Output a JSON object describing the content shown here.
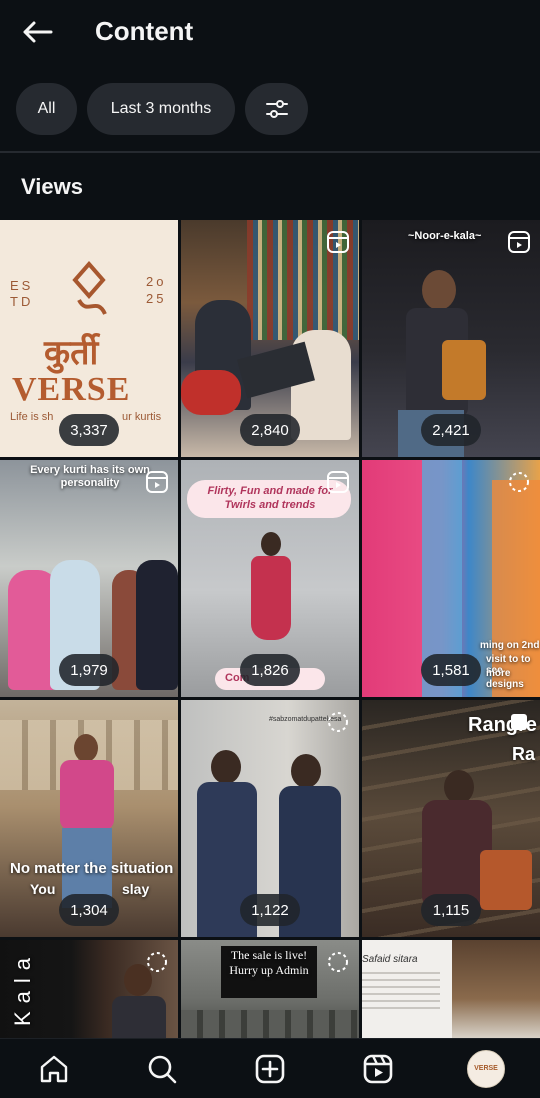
{
  "header": {
    "title": "Content"
  },
  "filters": {
    "all_label": "All",
    "range_label": "Last 3 months"
  },
  "section": {
    "title": "Views"
  },
  "tiles": [
    {
      "views": "3,337",
      "caption_top": "ES",
      "caption_top2": "TD",
      "caption_year1": "2o",
      "caption_year2": "25",
      "brand_hindi": "कुर्ती",
      "brand": "VERSE",
      "tagline": "Life is sh",
      "tagline2": "ur kurtis"
    },
    {
      "views": "2,840"
    },
    {
      "views": "2,421",
      "caption": "~Noor-e-kala~"
    },
    {
      "views": "1,979",
      "caption": "Every kurti has its own personality"
    },
    {
      "views": "1,826",
      "caption": "Flirty, Fun and made for Twirls and trends",
      "caption_bottom": "Com"
    },
    {
      "views": "1,581",
      "caption": "ming on 2nd",
      "caption2": "visit to to see",
      "caption3": "more designs"
    },
    {
      "views": "1,304",
      "caption": "No matter the situation",
      "caption2": "You",
      "caption3": "slay"
    },
    {
      "views": "1,122",
      "caption": "#sabzomatdupattekesa"
    },
    {
      "views": "1,115",
      "caption": "Rangre",
      "caption2": "Ra"
    },
    {
      "caption": "Kala"
    },
    {
      "caption": "The sale is live! Hurry up Admin"
    },
    {
      "caption": "Safaid sitara"
    }
  ],
  "nav": {
    "avatar_text": "VERSE"
  },
  "colors": {
    "background": "#0c1014",
    "chip": "#262a30",
    "text": "#f5f5f5"
  },
  "icons": [
    "back-arrow-icon",
    "filter-sliders-icon",
    "reel-icon",
    "loading-icon",
    "home-icon",
    "search-icon",
    "create-icon",
    "reels-icon"
  ]
}
